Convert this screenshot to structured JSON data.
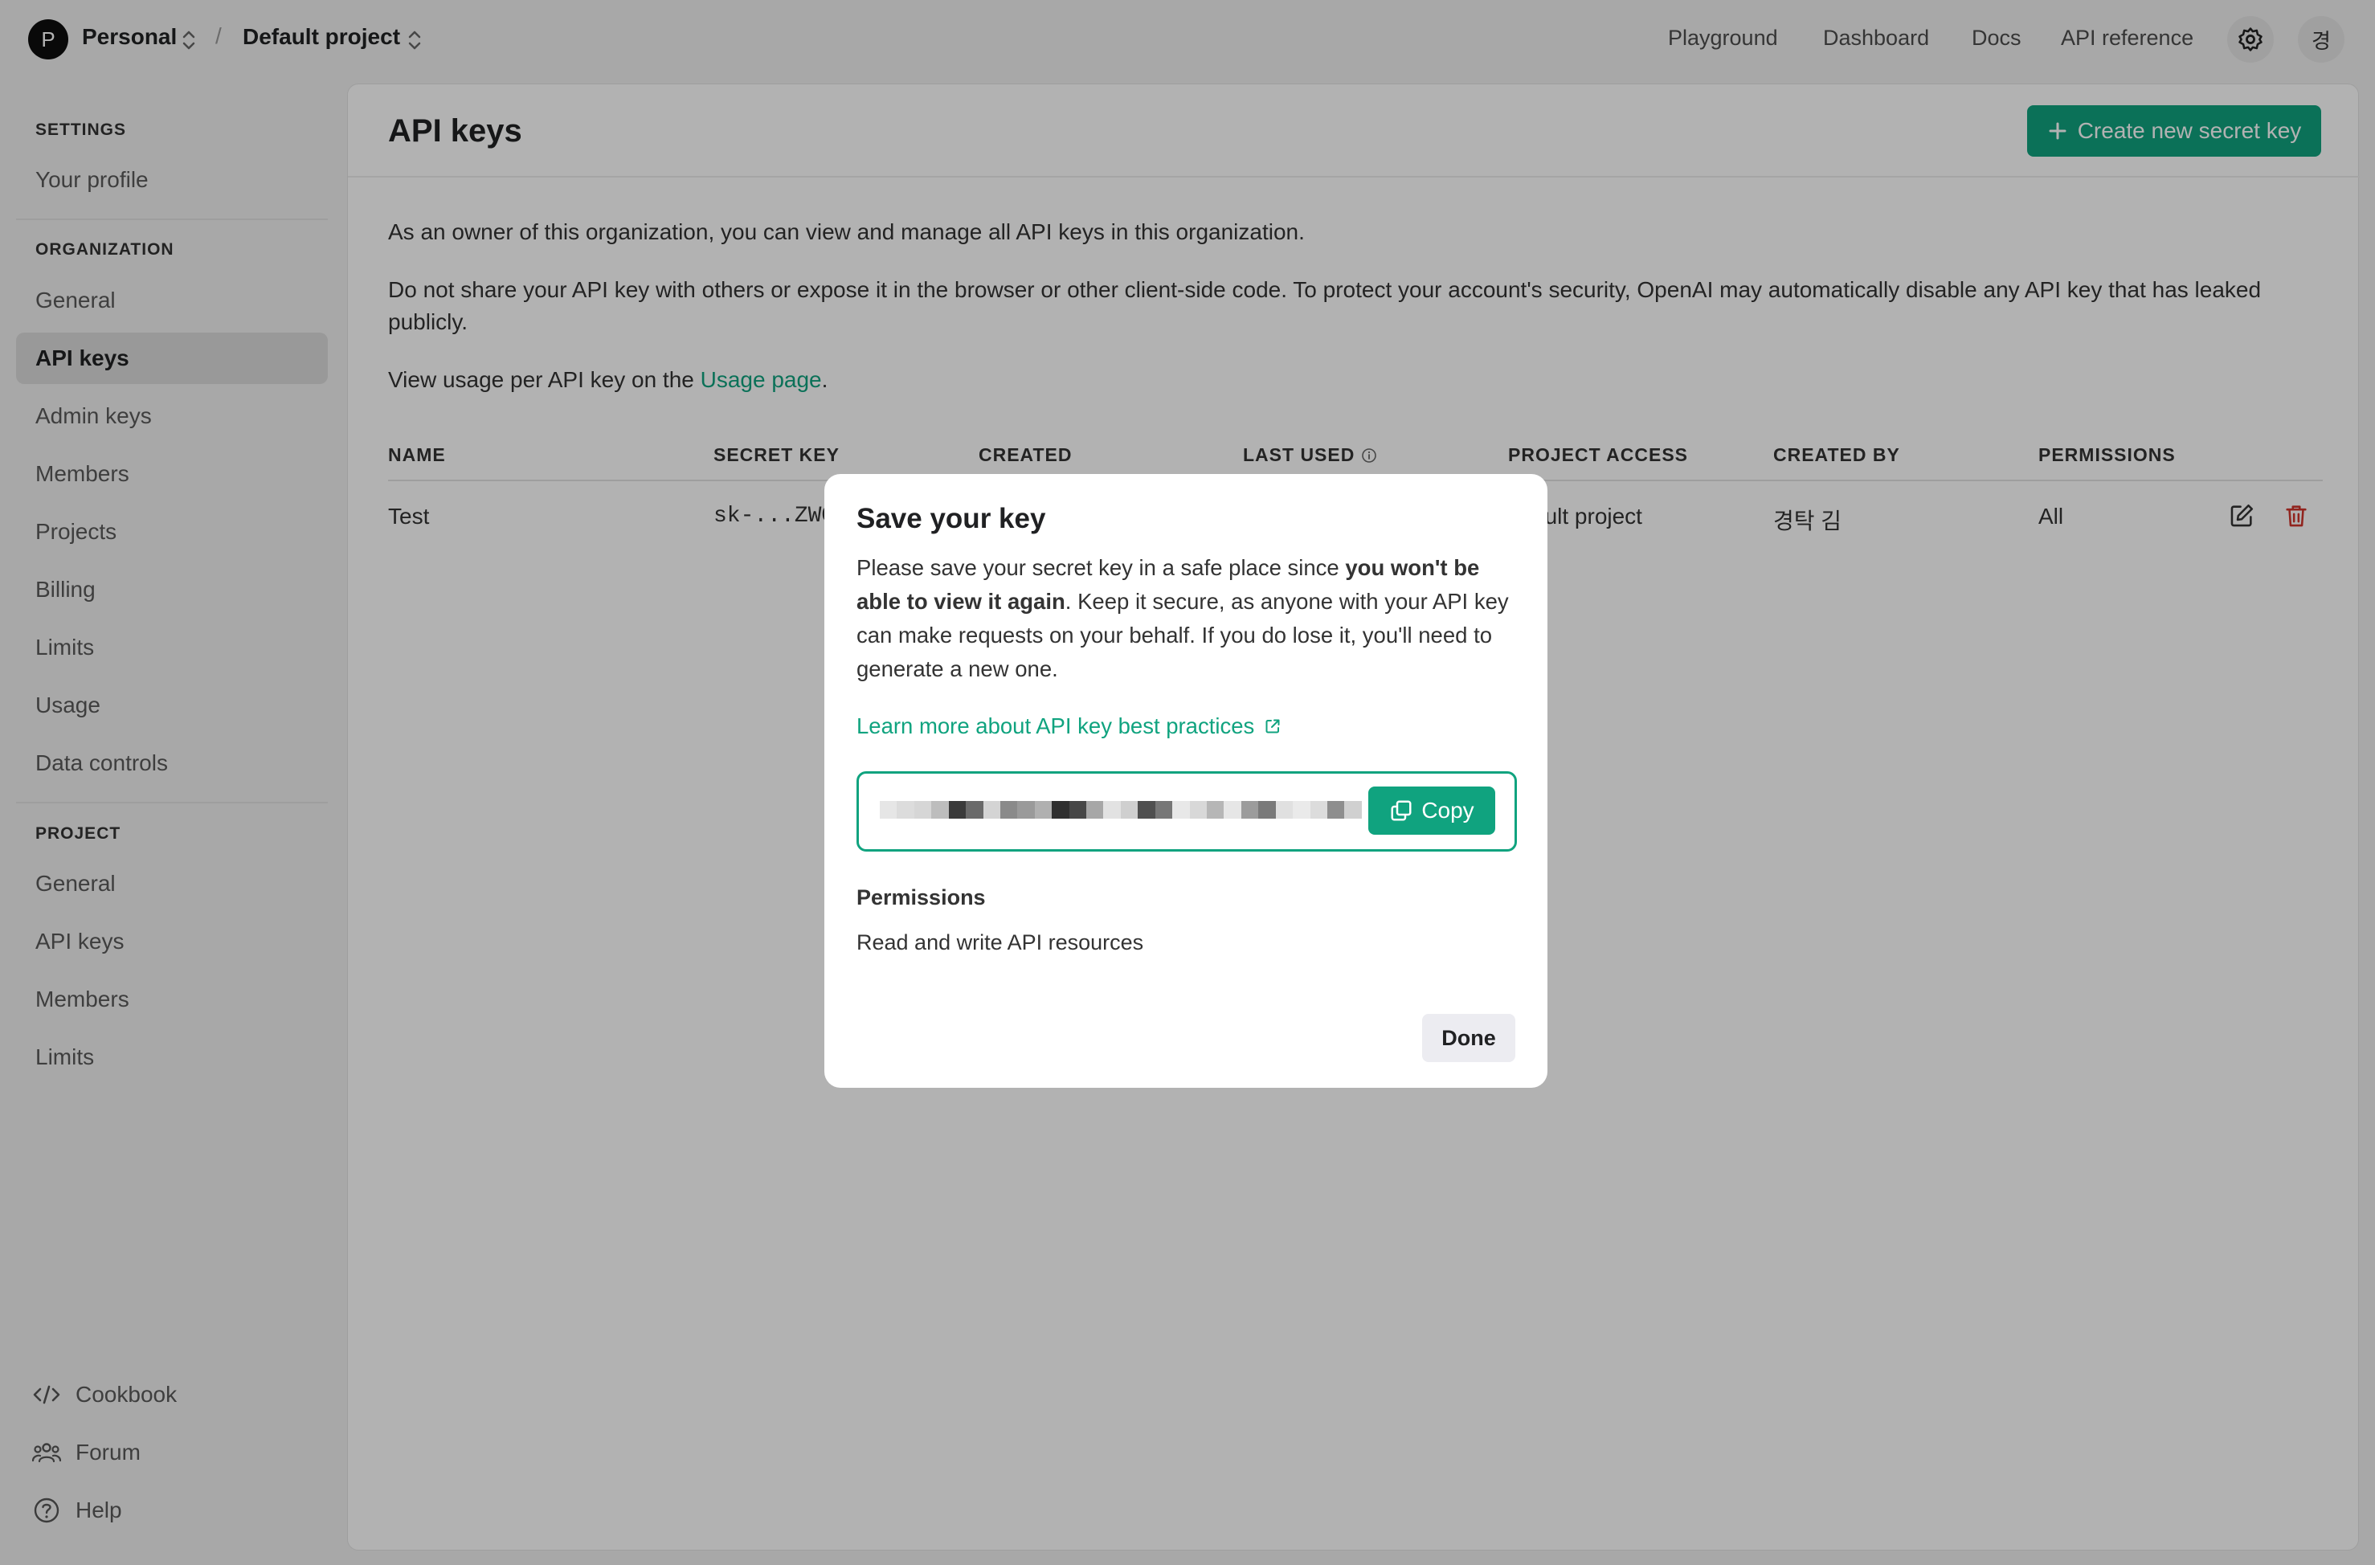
{
  "topbar": {
    "org_avatar": "P",
    "org_name": "Personal",
    "separator": "/",
    "project_name": "Default project",
    "nav": [
      "Playground",
      "Dashboard",
      "Docs",
      "API reference"
    ],
    "user_avatar": "경"
  },
  "sidebar": {
    "settings_heading": "SETTINGS",
    "your_profile": "Your profile",
    "org_heading": "ORGANIZATION",
    "org_items": [
      "General",
      "API keys",
      "Admin keys",
      "Members",
      "Projects",
      "Billing",
      "Limits",
      "Usage",
      "Data controls"
    ],
    "project_heading": "PROJECT",
    "project_items": [
      "General",
      "API keys",
      "Members",
      "Limits"
    ],
    "footer": [
      "Cookbook",
      "Forum",
      "Help"
    ]
  },
  "main": {
    "title": "API keys",
    "create_button": "Create new secret key",
    "para1": "As an owner of this organization, you can view and manage all API keys in this organization.",
    "para2": "Do not share your API key with others or expose it in the browser or other client-side code. To protect your account's security, OpenAI may automatically disable any API key that has leaked publicly.",
    "para3_prefix": "View usage per API key on the ",
    "para3_link": "Usage page",
    "para3_suffix": ".",
    "table": {
      "headers": [
        "NAME",
        "SECRET KEY",
        "CREATED",
        "LAST USED",
        "PROJECT ACCESS",
        "CREATED BY",
        "PERMISSIONS"
      ],
      "rows": [
        {
          "name": "Test",
          "secret_key": "sk-...ZWQ",
          "project_access": "ault project",
          "created_by": "경탁 김",
          "permissions": "All"
        }
      ]
    }
  },
  "modal": {
    "title": "Save your key",
    "text_pre": "Please save your secret key in a safe place since ",
    "text_bold": "you won't be able to view it again",
    "text_post": ". Keep it secure, as anyone with your API key can make requests on your behalf. If you do lose it, you'll need to generate a new one.",
    "learn_link": "Learn more about API key best practices",
    "copy_button": "Copy",
    "permissions_label": "Permissions",
    "permissions_value": "Read and write API resources",
    "done_button": "Done"
  },
  "colors": {
    "accent": "#10a37f",
    "danger": "#d0342c",
    "overlay": "rgba(0,0,0,0.3)"
  },
  "icons": [
    "chevron-updown-icon",
    "gear-icon",
    "plus-icon",
    "info-icon",
    "edit-icon",
    "trash-icon",
    "external-link-icon",
    "copy-icon",
    "code-icon",
    "people-icon",
    "help-icon"
  ]
}
